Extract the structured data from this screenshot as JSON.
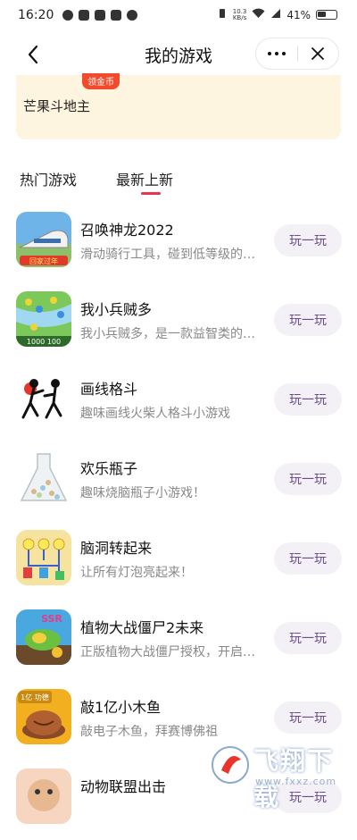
{
  "status_bar": {
    "time": "16:20",
    "net_speed_top": "10.3",
    "net_speed_bottom": "KB/s",
    "battery": "41%"
  },
  "nav": {
    "title": "我的游戏"
  },
  "promo": {
    "badge": "领金币",
    "title": "芒果斗地主"
  },
  "tabs": [
    {
      "label": "热门游戏",
      "active": false
    },
    {
      "label": "最新上新",
      "active": true
    }
  ],
  "colors": {
    "accent": "#e8344e",
    "play_button_bg": "#f3f0f6",
    "play_button_text": "#6b4c8f",
    "promo_bg": "#fdf5df"
  },
  "games": [
    {
      "name": "召唤神龙2022",
      "desc": "滑动骑行工具，碰到低等级的工具就能吃掉它",
      "button": "玩一玩",
      "icon_label": "回家过年",
      "icon": "train-game-icon"
    },
    {
      "name": "我小兵贼多",
      "desc": "我小兵贼多，是一款益智类的休闲游戏",
      "button": "玩一玩",
      "icon_label": "1000 100",
      "icon": "soldier-game-icon"
    },
    {
      "name": "画线格斗",
      "desc": "趣味画线火柴人格斗小游戏",
      "button": "玩一玩",
      "icon": "stickman-game-icon"
    },
    {
      "name": "欢乐瓶子",
      "desc": "趣味烧脑瓶子小游戏！",
      "button": "玩一玩",
      "icon": "bottle-game-icon"
    },
    {
      "name": "脑洞转起来",
      "desc": "让所有灯泡亮起来！",
      "button": "玩一玩",
      "icon": "bulb-game-icon"
    },
    {
      "name": "植物大战僵尸2未来",
      "desc": "正版植物大战僵尸授权，开启未来之旅",
      "button": "玩一玩",
      "icon_label": "SSR",
      "icon": "pvz-game-icon"
    },
    {
      "name": "敲1亿小木鱼",
      "desc": "敲电子木鱼，拜赛博佛祖",
      "button": "玩一玩",
      "icon_label": "1亿 功德",
      "icon": "wooden-fish-game-icon"
    },
    {
      "name": "动物联盟出击",
      "desc": "",
      "button": "玩一玩",
      "icon": "animal-game-icon"
    }
  ],
  "watermark": {
    "text": "飞翔下载",
    "url": "www.fxxz.com"
  }
}
